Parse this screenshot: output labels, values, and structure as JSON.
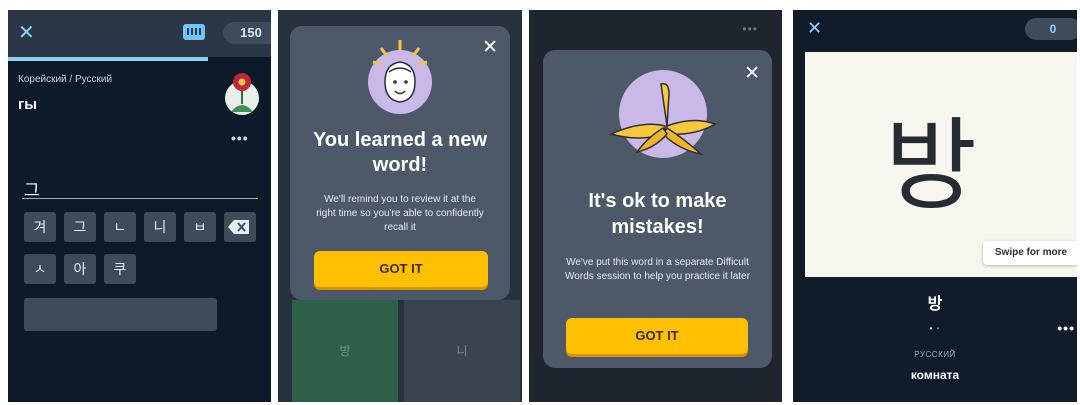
{
  "panel1": {
    "close_glyph": "✕",
    "points": "150",
    "language_pair": "Корейский / Русский",
    "word": "гы",
    "more_glyph": "•••",
    "typed_text": "그",
    "keys_row1": [
      "겨",
      "그",
      "ㄴ",
      "니",
      "ㅂ"
    ],
    "keys_row2": [
      "ㅅ",
      "아",
      "쿠"
    ],
    "backspace_glyph": "✕",
    "progress": 0.76
  },
  "panel2": {
    "close_glyph": "✕",
    "title": "You learned a new word!",
    "body": "We'll remind you to review it at the right time so you're able to confidently recall it",
    "button": "GOT IT",
    "tile_left": "방",
    "tile_right": "니"
  },
  "panel3": {
    "dots": "•••",
    "close_glyph": "✕",
    "title": "It's ok to make mistakes!",
    "body": "We've put this word in a separate Difficult Words session to help you practice it later",
    "button": "GOT IT"
  },
  "panel4": {
    "close_glyph": "✕",
    "points": "0",
    "big_word": "방",
    "swipe_hint": "Swipe for more",
    "word": "방",
    "pager_on": "•",
    "pager_off": "•",
    "more_glyph": "•••",
    "label": "РУССКИЙ",
    "translation": "комната"
  },
  "colors": {
    "accent_yellow": "#ffc001",
    "accent_blue": "#8fd2ff",
    "modal_bg": "#4d5969"
  }
}
